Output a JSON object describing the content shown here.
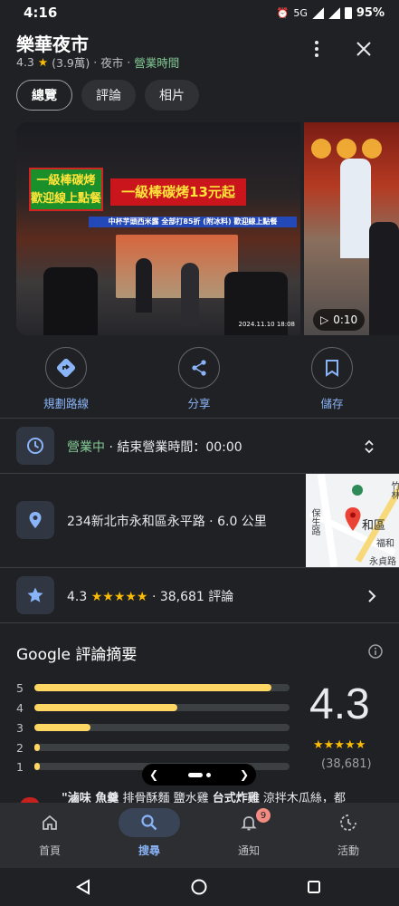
{
  "status_bar": {
    "time": "4:16",
    "network": "5G",
    "battery": "95%"
  },
  "place": {
    "name": "樂華夜市",
    "rating": "4.3",
    "review_count_short": "(3.9萬)",
    "category": "夜市",
    "open_state": "營業時間"
  },
  "tabs": [
    {
      "label": "總覽",
      "active": true
    },
    {
      "label": "評論",
      "active": false
    },
    {
      "label": "相片",
      "active": false
    }
  ],
  "photos": {
    "sign_left": "一級棒碳烤\n歡迎線上點餐",
    "sign_main": "一級棒碳烤13元起",
    "sign_strip": "中杯芋頭西米露 全部打85折 (附冰料)   歡迎線上點餐",
    "timestamp": "2024.11.10 18:08",
    "video_duration": "0:10"
  },
  "actions": [
    {
      "label": "規劃路線",
      "icon": "directions-icon"
    },
    {
      "label": "分享",
      "icon": "share-icon"
    },
    {
      "label": "儲存",
      "icon": "bookmark-icon"
    }
  ],
  "hours": {
    "status": "營業中",
    "detail": "結束營業時間：00:00"
  },
  "address": {
    "text": "234新北市永和區永平路",
    "distance": "6.0 公里"
  },
  "map_labels": {
    "a": "保生路",
    "b": "和區",
    "c": "竹林",
    "d": "福和",
    "e": "永貞路"
  },
  "reviews_row": {
    "rating": "4.3",
    "stars": "★★★★★",
    "count": "38,681 評論"
  },
  "summary": {
    "title": "Google 評論摘要",
    "rating": "4.3",
    "count": "(38,681)",
    "stars": "★★★★★",
    "distribution": [
      {
        "stars": "5",
        "fraction": 0.93
      },
      {
        "stars": "4",
        "fraction": 0.56
      },
      {
        "stars": "3",
        "fraction": 0.22
      },
      {
        "stars": "2",
        "fraction": 0.02
      },
      {
        "stars": "1",
        "fraction": 0.02
      }
    ],
    "keywords_bold_1": "\"滷味 魚羹",
    "keywords_plain_1": " 排骨酥麵 鹽水雞 ",
    "keywords_bold_2": "台式炸雞",
    "keywords_plain_2": " 涼拌木瓜絲，都"
  },
  "bottom_nav": [
    {
      "label": "首頁",
      "icon": "home-icon",
      "active": false
    },
    {
      "label": "搜尋",
      "icon": "search-icon",
      "active": true
    },
    {
      "label": "通知",
      "icon": "bell-icon",
      "active": false,
      "badge": "9"
    },
    {
      "label": "活動",
      "icon": "activity-icon",
      "active": false
    }
  ],
  "colors": {
    "background": "#202124",
    "accent": "#8ab4f8",
    "star": "#fbbc04",
    "open": "#81c995"
  }
}
